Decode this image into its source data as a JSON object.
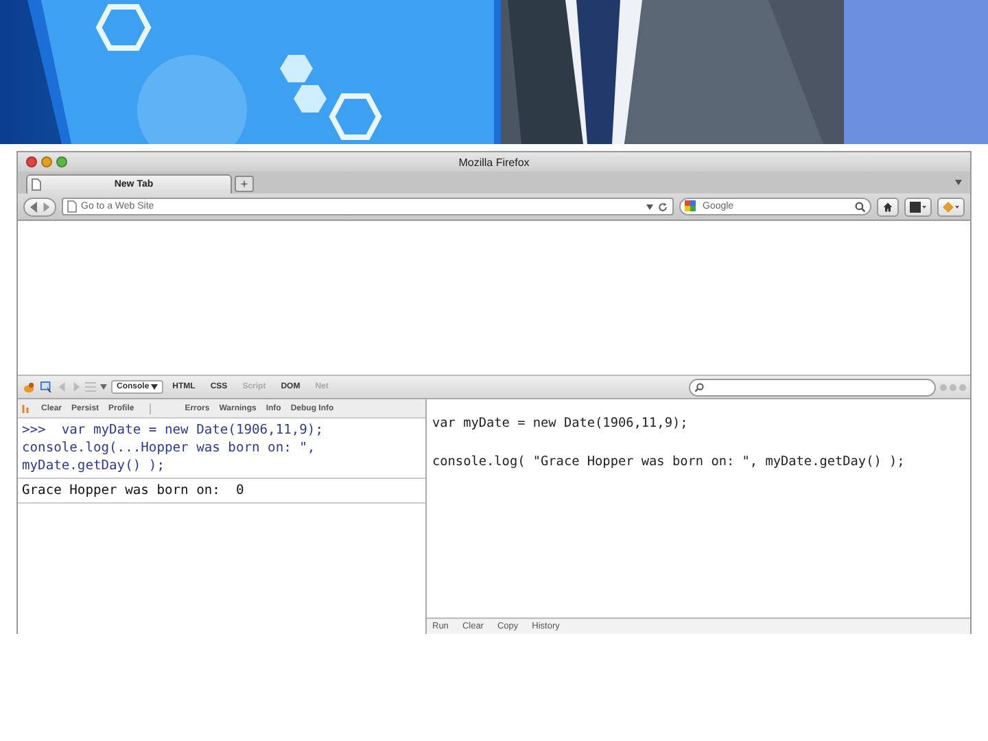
{
  "window": {
    "title": "Mozilla Firefox"
  },
  "tabs": [
    {
      "label": "New Tab",
      "selected": true
    }
  ],
  "new_tab_button": "+",
  "navbar": {
    "url_placeholder": "Go to a Web Site",
    "search_placeholder": "Google"
  },
  "firebug": {
    "tabs": [
      {
        "label": "Console",
        "selected": true,
        "disabled": false,
        "menu": true
      },
      {
        "label": "HTML",
        "selected": false,
        "disabled": false,
        "menu": false
      },
      {
        "label": "CSS",
        "selected": false,
        "disabled": false,
        "menu": false
      },
      {
        "label": "Script",
        "selected": false,
        "disabled": true,
        "menu": false
      },
      {
        "label": "DOM",
        "selected": false,
        "disabled": false,
        "menu": false
      },
      {
        "label": "Net",
        "selected": false,
        "disabled": true,
        "menu": false
      }
    ],
    "console_buttons": [
      "Clear",
      "Persist",
      "Profile"
    ],
    "filters": [
      "Errors",
      "Warnings",
      "Info",
      "Debug Info"
    ],
    "console": [
      {
        "kind": "command",
        "prompt": ">>>",
        "lines": [
          "  var myDate = new Date(1906,11,9);",
          "console.log(...Hopper was born on: \",",
          "myDate.getDay() );"
        ]
      },
      {
        "kind": "output",
        "lines": [
          "Grace Hopper was born on:  0"
        ]
      }
    ],
    "editor_lines": [
      "var myDate = new Date(1906,11,9);",
      "console.log( \"Grace Hopper was born on: \", myDate.getDay() );"
    ],
    "editor_buttons": [
      "Run",
      "Clear",
      "Copy",
      "History"
    ]
  }
}
